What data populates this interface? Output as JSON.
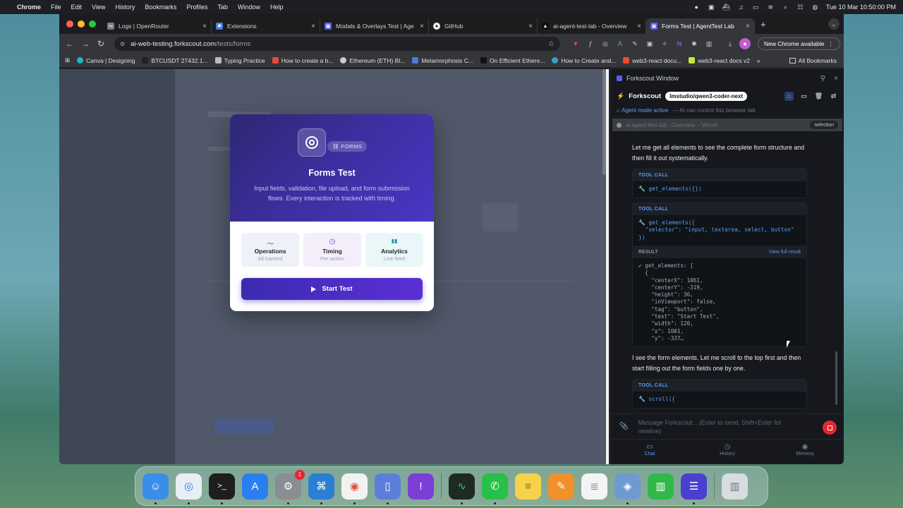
{
  "menubar": {
    "app": "Chrome",
    "items": [
      "File",
      "Edit",
      "View",
      "History",
      "Bookmarks",
      "Profiles",
      "Tab",
      "Window",
      "Help"
    ],
    "datetime": "Tue 10 Mar  10:50:00 PM"
  },
  "tabs": [
    {
      "title": "Logs | OpenRouter",
      "color": "#7a7f88"
    },
    {
      "title": "Extensions",
      "color": "#4a7bd8"
    },
    {
      "title": "Modals & Overlays Test | Age",
      "color": "#5b5ef0"
    },
    {
      "title": "GitHub",
      "color": "#eeeeee"
    },
    {
      "title": "ai-agent-test-lab - Overview",
      "color": "#111111"
    },
    {
      "title": "Forms Test | AgentTest Lab",
      "color": "#5b5ef0"
    }
  ],
  "address": {
    "host": "ai-web-testing.forkscout.com",
    "path": "/tests/forms"
  },
  "new_chrome": "New Chrome available",
  "bookmarks": [
    {
      "label": "Canva | Designing",
      "color": "#1fb6c8"
    },
    {
      "label": "BTCUSDT 27432.1...",
      "color": "#222222"
    },
    {
      "label": "Typing Practice",
      "color": "#bbbbbb"
    },
    {
      "label": "How to create a b...",
      "color": "#e94b35"
    },
    {
      "label": "Ethereum (ETH) Bl...",
      "color": "#cccccc"
    },
    {
      "label": "Metamorphosis C...",
      "color": "#4d7bd8"
    },
    {
      "label": "On Efficient Ethere...",
      "color": "#111111"
    },
    {
      "label": "How to Create and...",
      "color": "#3aa0c8"
    },
    {
      "label": "web3-react docu...",
      "color": "#e94b35"
    },
    {
      "label": "web3-react docs v2",
      "color": "#c6e63a"
    }
  ],
  "all_bookmarks": "All Bookmarks",
  "modal": {
    "badge": "FORMS",
    "title": "Forms Test",
    "description": "Input fields, validation, file upload, and form submission flows. Every interaction is tracked with timing.",
    "cards": [
      {
        "label": "Operations",
        "sub": "All tracked",
        "bg": "#eef1f8",
        "icon_color": "#3b4fd0",
        "icon": "〜"
      },
      {
        "label": "Timing",
        "sub": "Per action",
        "bg": "#f4eefb",
        "icon_color": "#7a3fd0",
        "icon": "◷"
      },
      {
        "label": "Analytics",
        "sub": "Live feed",
        "bg": "#eaf7f8",
        "icon_color": "#1a9aa8",
        "icon": "▮▮"
      }
    ],
    "start_button": "Start Test"
  },
  "panel": {
    "window_title": "Forkscout Window",
    "brand": "Forkscout",
    "model": "lmstudio/qwen3-coder-next",
    "agent_mode": "Agent mode active",
    "agent_sub": "— AI can control this browser tab",
    "tab_label": "ai-agent-test-lab - Overview – Vercel",
    "selection": "selection",
    "chat": {
      "msg1": "Let me get all elements to see the complete form structure and then fill it out systematically.",
      "tool_label": "TOOL CALL",
      "call1": "🔧 get_elements({})",
      "call2": "🔧 get_elements({\n  \"selector\": \"input, textarea, select, button\"\n})",
      "result_label": "RESULT",
      "view_full": "View full result",
      "result_head": "get_elements: [",
      "result_body": "  {\n    \"centerX\": 1061,\n    \"centerY\": -319,\n    \"height\": 36,\n    \"inViewport\": false,\n    \"tag\": \"button\",\n    \"text\": \"Start Test\",\n    \"width\": 120,\n    \"x\": 1001,\n    \"y\": -337…",
      "msg2": "I see the form elements. Let me scroll to the top first and then start filling out the form fields one by one.",
      "call3": "🔧 scroll({"
    },
    "input_placeholder": "Message Forkscout... (Enter to send, Shift+Enter for newline)",
    "nav": [
      "Chat",
      "History",
      "Memory"
    ]
  },
  "dock": [
    {
      "name": "finder",
      "color": "#3a8ee8",
      "glyph": "☺"
    },
    {
      "name": "safari",
      "color": "#e8eef5",
      "glyph": "◎"
    },
    {
      "name": "terminal",
      "color": "#1e1e1e",
      "glyph": ">_"
    },
    {
      "name": "app-store",
      "color": "#2a7ff0",
      "glyph": "A"
    },
    {
      "name": "system-settings",
      "color": "#8a8d93",
      "glyph": "⚙",
      "badge": "1"
    },
    {
      "name": "vscode",
      "color": "#2a7fd4",
      "glyph": "⌘"
    },
    {
      "name": "chrome",
      "color": "#f2f2f2",
      "glyph": "◉"
    },
    {
      "name": "remote",
      "color": "#5b7fd8",
      "glyph": "▯"
    },
    {
      "name": "feedback",
      "color": "#7b3fd8",
      "glyph": "!"
    },
    {
      "name": "activity-monitor",
      "color": "#1f2a22",
      "glyph": "∿"
    },
    {
      "name": "whatsapp",
      "color": "#27c04a",
      "glyph": "✆"
    },
    {
      "name": "notes",
      "color": "#f5d24a",
      "glyph": "≡"
    },
    {
      "name": "pages",
      "color": "#f2902a",
      "glyph": "✎"
    },
    {
      "name": "textedit",
      "color": "#f4f4f4",
      "glyph": "≣"
    },
    {
      "name": "preview",
      "color": "#6f9ad0",
      "glyph": "◈"
    },
    {
      "name": "numbers",
      "color": "#30b948",
      "glyph": "▥"
    },
    {
      "name": "linear",
      "color": "#4b3fd0",
      "glyph": "☰"
    },
    {
      "name": "trash",
      "color": "#d5dde0",
      "glyph": "▥"
    }
  ]
}
